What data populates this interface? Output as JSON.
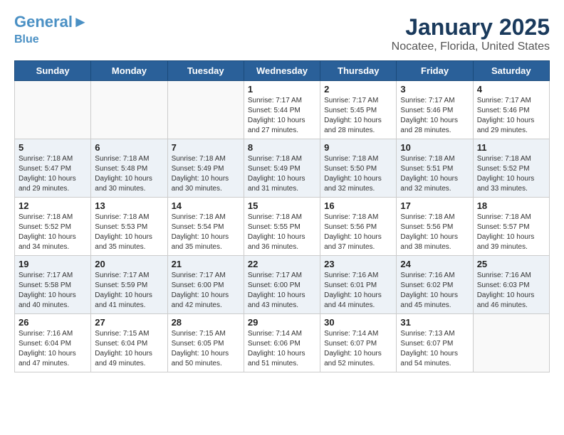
{
  "header": {
    "logo_main": "General",
    "logo_accent": "Blue",
    "title": "January 2025",
    "subtitle": "Nocatee, Florida, United States"
  },
  "days_of_week": [
    "Sunday",
    "Monday",
    "Tuesday",
    "Wednesday",
    "Thursday",
    "Friday",
    "Saturday"
  ],
  "weeks": [
    {
      "days": [
        {
          "number": "",
          "info": ""
        },
        {
          "number": "",
          "info": ""
        },
        {
          "number": "",
          "info": ""
        },
        {
          "number": "1",
          "info": "Sunrise: 7:17 AM\nSunset: 5:44 PM\nDaylight: 10 hours\nand 27 minutes."
        },
        {
          "number": "2",
          "info": "Sunrise: 7:17 AM\nSunset: 5:45 PM\nDaylight: 10 hours\nand 28 minutes."
        },
        {
          "number": "3",
          "info": "Sunrise: 7:17 AM\nSunset: 5:46 PM\nDaylight: 10 hours\nand 28 minutes."
        },
        {
          "number": "4",
          "info": "Sunrise: 7:17 AM\nSunset: 5:46 PM\nDaylight: 10 hours\nand 29 minutes."
        }
      ]
    },
    {
      "days": [
        {
          "number": "5",
          "info": "Sunrise: 7:18 AM\nSunset: 5:47 PM\nDaylight: 10 hours\nand 29 minutes."
        },
        {
          "number": "6",
          "info": "Sunrise: 7:18 AM\nSunset: 5:48 PM\nDaylight: 10 hours\nand 30 minutes."
        },
        {
          "number": "7",
          "info": "Sunrise: 7:18 AM\nSunset: 5:49 PM\nDaylight: 10 hours\nand 30 minutes."
        },
        {
          "number": "8",
          "info": "Sunrise: 7:18 AM\nSunset: 5:49 PM\nDaylight: 10 hours\nand 31 minutes."
        },
        {
          "number": "9",
          "info": "Sunrise: 7:18 AM\nSunset: 5:50 PM\nDaylight: 10 hours\nand 32 minutes."
        },
        {
          "number": "10",
          "info": "Sunrise: 7:18 AM\nSunset: 5:51 PM\nDaylight: 10 hours\nand 32 minutes."
        },
        {
          "number": "11",
          "info": "Sunrise: 7:18 AM\nSunset: 5:52 PM\nDaylight: 10 hours\nand 33 minutes."
        }
      ]
    },
    {
      "days": [
        {
          "number": "12",
          "info": "Sunrise: 7:18 AM\nSunset: 5:52 PM\nDaylight: 10 hours\nand 34 minutes."
        },
        {
          "number": "13",
          "info": "Sunrise: 7:18 AM\nSunset: 5:53 PM\nDaylight: 10 hours\nand 35 minutes."
        },
        {
          "number": "14",
          "info": "Sunrise: 7:18 AM\nSunset: 5:54 PM\nDaylight: 10 hours\nand 35 minutes."
        },
        {
          "number": "15",
          "info": "Sunrise: 7:18 AM\nSunset: 5:55 PM\nDaylight: 10 hours\nand 36 minutes."
        },
        {
          "number": "16",
          "info": "Sunrise: 7:18 AM\nSunset: 5:56 PM\nDaylight: 10 hours\nand 37 minutes."
        },
        {
          "number": "17",
          "info": "Sunrise: 7:18 AM\nSunset: 5:56 PM\nDaylight: 10 hours\nand 38 minutes."
        },
        {
          "number": "18",
          "info": "Sunrise: 7:18 AM\nSunset: 5:57 PM\nDaylight: 10 hours\nand 39 minutes."
        }
      ]
    },
    {
      "days": [
        {
          "number": "19",
          "info": "Sunrise: 7:17 AM\nSunset: 5:58 PM\nDaylight: 10 hours\nand 40 minutes."
        },
        {
          "number": "20",
          "info": "Sunrise: 7:17 AM\nSunset: 5:59 PM\nDaylight: 10 hours\nand 41 minutes."
        },
        {
          "number": "21",
          "info": "Sunrise: 7:17 AM\nSunset: 6:00 PM\nDaylight: 10 hours\nand 42 minutes."
        },
        {
          "number": "22",
          "info": "Sunrise: 7:17 AM\nSunset: 6:00 PM\nDaylight: 10 hours\nand 43 minutes."
        },
        {
          "number": "23",
          "info": "Sunrise: 7:16 AM\nSunset: 6:01 PM\nDaylight: 10 hours\nand 44 minutes."
        },
        {
          "number": "24",
          "info": "Sunrise: 7:16 AM\nSunset: 6:02 PM\nDaylight: 10 hours\nand 45 minutes."
        },
        {
          "number": "25",
          "info": "Sunrise: 7:16 AM\nSunset: 6:03 PM\nDaylight: 10 hours\nand 46 minutes."
        }
      ]
    },
    {
      "days": [
        {
          "number": "26",
          "info": "Sunrise: 7:16 AM\nSunset: 6:04 PM\nDaylight: 10 hours\nand 47 minutes."
        },
        {
          "number": "27",
          "info": "Sunrise: 7:15 AM\nSunset: 6:04 PM\nDaylight: 10 hours\nand 49 minutes."
        },
        {
          "number": "28",
          "info": "Sunrise: 7:15 AM\nSunset: 6:05 PM\nDaylight: 10 hours\nand 50 minutes."
        },
        {
          "number": "29",
          "info": "Sunrise: 7:14 AM\nSunset: 6:06 PM\nDaylight: 10 hours\nand 51 minutes."
        },
        {
          "number": "30",
          "info": "Sunrise: 7:14 AM\nSunset: 6:07 PM\nDaylight: 10 hours\nand 52 minutes."
        },
        {
          "number": "31",
          "info": "Sunrise: 7:13 AM\nSunset: 6:07 PM\nDaylight: 10 hours\nand 54 minutes."
        },
        {
          "number": "",
          "info": ""
        }
      ]
    }
  ]
}
